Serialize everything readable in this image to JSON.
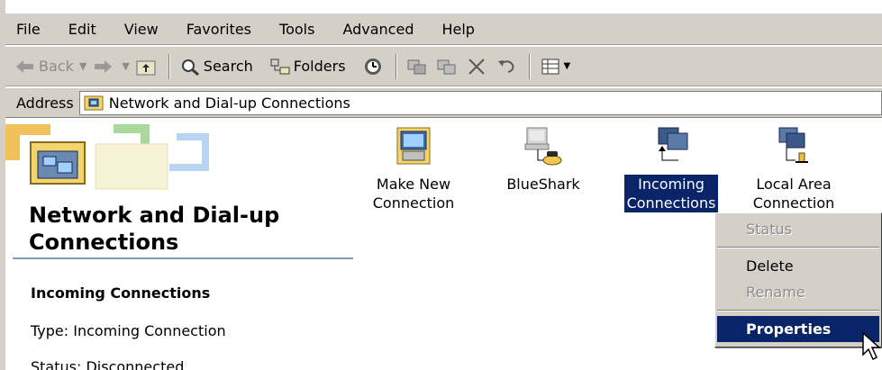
{
  "menubar": {
    "items": [
      "File",
      "Edit",
      "View",
      "Favorites",
      "Tools",
      "Advanced",
      "Help"
    ]
  },
  "toolbar": {
    "back": "Back",
    "search": "Search",
    "folders": "Folders"
  },
  "addressbar": {
    "label": "Address",
    "value": "Network and Dial-up Connections"
  },
  "left_panel": {
    "title_line1": "Network and Dial-up",
    "title_line2": "Connections",
    "heading": "Incoming Connections",
    "type": "Type: Incoming Connection",
    "status": "Status: Disconnected"
  },
  "icons": [
    {
      "line1": "Make New",
      "line2": "Connection"
    },
    {
      "line1": "BlueShark",
      "line2": ""
    },
    {
      "line1": "Incoming",
      "line2": "Connections"
    },
    {
      "line1": "Local Area",
      "line2": "Connection"
    }
  ],
  "context_menu": {
    "status": "Status",
    "delete": "Delete",
    "rename": "Rename",
    "properties": "Properties"
  },
  "colors": {
    "selection": "#0a246a",
    "chrome": "#d4d0c8",
    "divider": "#7f9db9"
  }
}
